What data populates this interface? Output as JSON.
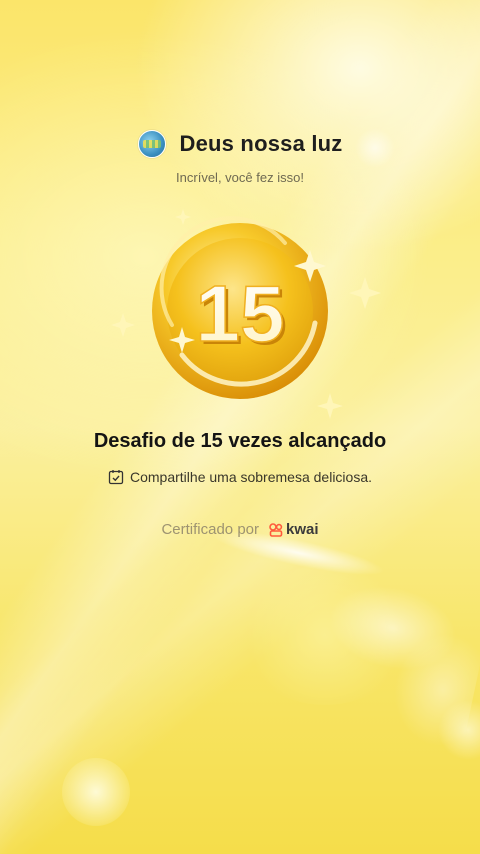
{
  "header": {
    "title": "Deus nossa luz",
    "subtitle": "Incrível, você fez isso!",
    "avatar_icon": "avatar"
  },
  "medal": {
    "number": "15",
    "icon": "gold-medal-icon",
    "colors": {
      "gold_light": "#fde58a",
      "gold": "#f5c11d",
      "gold_dark": "#d98c06"
    }
  },
  "achievement": {
    "title": "Desafio de 15 vezes alcançado",
    "task_icon": "calendar-check-icon",
    "task_text": "Compartilhe uma sobremesa deliciosa."
  },
  "certified": {
    "label": "Certificado por",
    "brand": "kwai",
    "brand_icon": "kwai-logo-icon",
    "brand_color": "#ff5a3c"
  }
}
